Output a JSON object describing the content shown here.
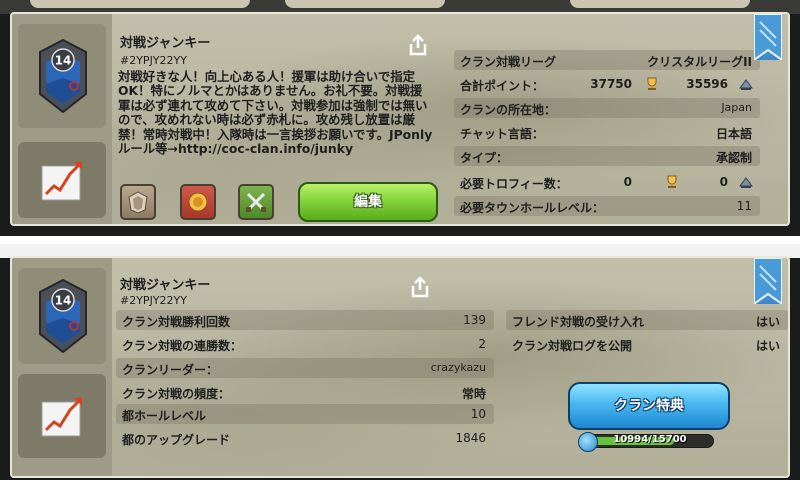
{
  "clan": {
    "name": "対戦ジャンキー",
    "tag": "#2YPJY22YY",
    "level": "14",
    "description": "対戦好きな人！向上心ある人！援軍は助け合いで指定OK！特にノルマとかはありません。お礼不要。対戦援軍は必ず連れて攻めて下さい。対戦参加は強制では無いので、攻めれない時は必ず赤札に。攻め残し放置は厳禁！常時対戦中！入隊時は一言挨拶お願いです。JPonly ルール等→http://coc-clan.info/junky"
  },
  "panel1": {
    "edit_button": "編集",
    "info": [
      {
        "key": "クラン対戦リーグ",
        "value": "クリスタルリーグII"
      },
      {
        "key": "合計ポイント：",
        "value_a": "37750",
        "value_b": "35596"
      },
      {
        "key": "クランの所在地：",
        "value": "Japan"
      },
      {
        "key": "チャット言語：",
        "value": "日本語"
      },
      {
        "key": "タイプ：",
        "value": "承認制"
      },
      {
        "key": "必要トロフィー数：",
        "value_a": "0",
        "value_b": "0"
      },
      {
        "key": "必要タウンホールレベル：",
        "value": "11"
      }
    ]
  },
  "panel2": {
    "left_rows": [
      {
        "key": "クラン対戦勝利回数",
        "value": "139"
      },
      {
        "key": "クラン対戦の連勝数：",
        "value": "2"
      },
      {
        "key": "クランリーダー：",
        "value": "crazykazu"
      },
      {
        "key": "クラン対戦の頻度：",
        "value": "常時"
      },
      {
        "key": "都ホールレベル",
        "value": "10"
      },
      {
        "key": "都のアップグレード",
        "value": "1846"
      }
    ],
    "right_rows": [
      {
        "key": "フレンド対戦の受け入れ",
        "value": "はい"
      },
      {
        "key": "クラン対戦ログを公開",
        "value": "はい"
      }
    ],
    "perks_button": "クラン特典",
    "progress": {
      "text": "10994/15700",
      "current": 10994,
      "max": 15700
    }
  },
  "colors": {
    "green_button": "#84d43a",
    "blue_button": "#48b8f0",
    "panel_bg": "#b9b6a0",
    "bookmark": "#3b87c8"
  },
  "icons": [
    "share-icon",
    "trophy-icon",
    "builder-trophy-icon",
    "clan-badge-icon",
    "graph-icon",
    "war-helmet-icon",
    "clan-shield-icon",
    "crossed-swords-icon",
    "capital-gold-icon",
    "bookmark-icon"
  ]
}
